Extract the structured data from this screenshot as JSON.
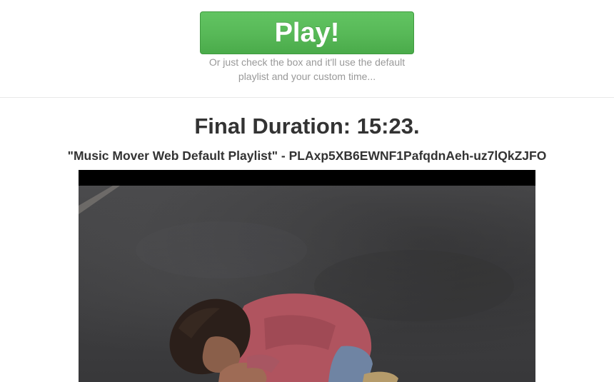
{
  "play": {
    "button_label": "Play!",
    "hint": "Or just check the box and it'll use the default playlist and your custom time..."
  },
  "result": {
    "final_duration": "Final Duration: 15:23.",
    "playlist_line": "\"Music Mover Web Default Playlist\" - PLAxp5XB6EWNF1PafqdnAeh-uz7lQkZJFO"
  },
  "colors": {
    "play_button": "#5cb85c",
    "heading_text": "#333333",
    "hint_text": "#999999"
  }
}
